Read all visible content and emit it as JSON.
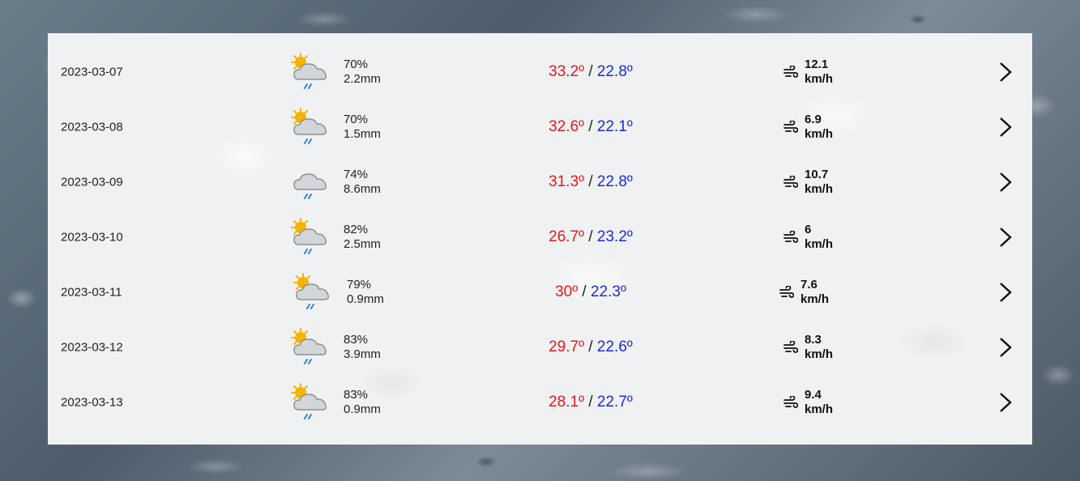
{
  "forecast": [
    {
      "date": "2023-03-07",
      "icon": "partly-cloudy-rain-icon",
      "humidity": "70%",
      "rain": "2.2mm",
      "tmax": "33.2º",
      "tmin": "22.8º",
      "wind_speed": "12.1",
      "wind_unit": "km/h"
    },
    {
      "date": "2023-03-08",
      "icon": "partly-cloudy-rain-icon",
      "humidity": "70%",
      "rain": "1.5mm",
      "tmax": "32.6º",
      "tmin": "22.1º",
      "wind_speed": "6.9",
      "wind_unit": "km/h"
    },
    {
      "date": "2023-03-09",
      "icon": "cloud-rain-icon",
      "humidity": "74%",
      "rain": "8.6mm",
      "tmax": "31.3º",
      "tmin": "22.8º",
      "wind_speed": "10.7",
      "wind_unit": "km/h"
    },
    {
      "date": "2023-03-10",
      "icon": "partly-cloudy-rain-icon",
      "humidity": "82%",
      "rain": "2.5mm",
      "tmax": "26.7º",
      "tmin": "23.2º",
      "wind_speed": "6",
      "wind_unit": "km/h"
    },
    {
      "date": "2023-03-11",
      "icon": "partly-cloudy-rain-icon",
      "humidity": "79%",
      "rain": "0.9mm",
      "tmax": "30º",
      "tmin": "22.3º",
      "wind_speed": "7.6",
      "wind_unit": "km/h"
    },
    {
      "date": "2023-03-12",
      "icon": "partly-cloudy-rain-icon",
      "humidity": "83%",
      "rain": "3.9mm",
      "tmax": "29.7º",
      "tmin": "22.6º",
      "wind_speed": "8.3",
      "wind_unit": "km/h"
    },
    {
      "date": "2023-03-13",
      "icon": "partly-cloudy-rain-icon",
      "humidity": "83%",
      "rain": "0.9mm",
      "tmax": "28.1º",
      "tmin": "22.7º",
      "wind_speed": "9.4",
      "wind_unit": "km/h"
    }
  ],
  "temp_separator": " / ",
  "colors": {
    "tmax": "#e01a1a",
    "tmin": "#1a2bd8",
    "sun": "#f4b400",
    "cloud": "#c9ccd0",
    "rain": "#2a86d8"
  },
  "icons": {
    "wind": "wind-icon",
    "details": "chevron-right-icon"
  }
}
